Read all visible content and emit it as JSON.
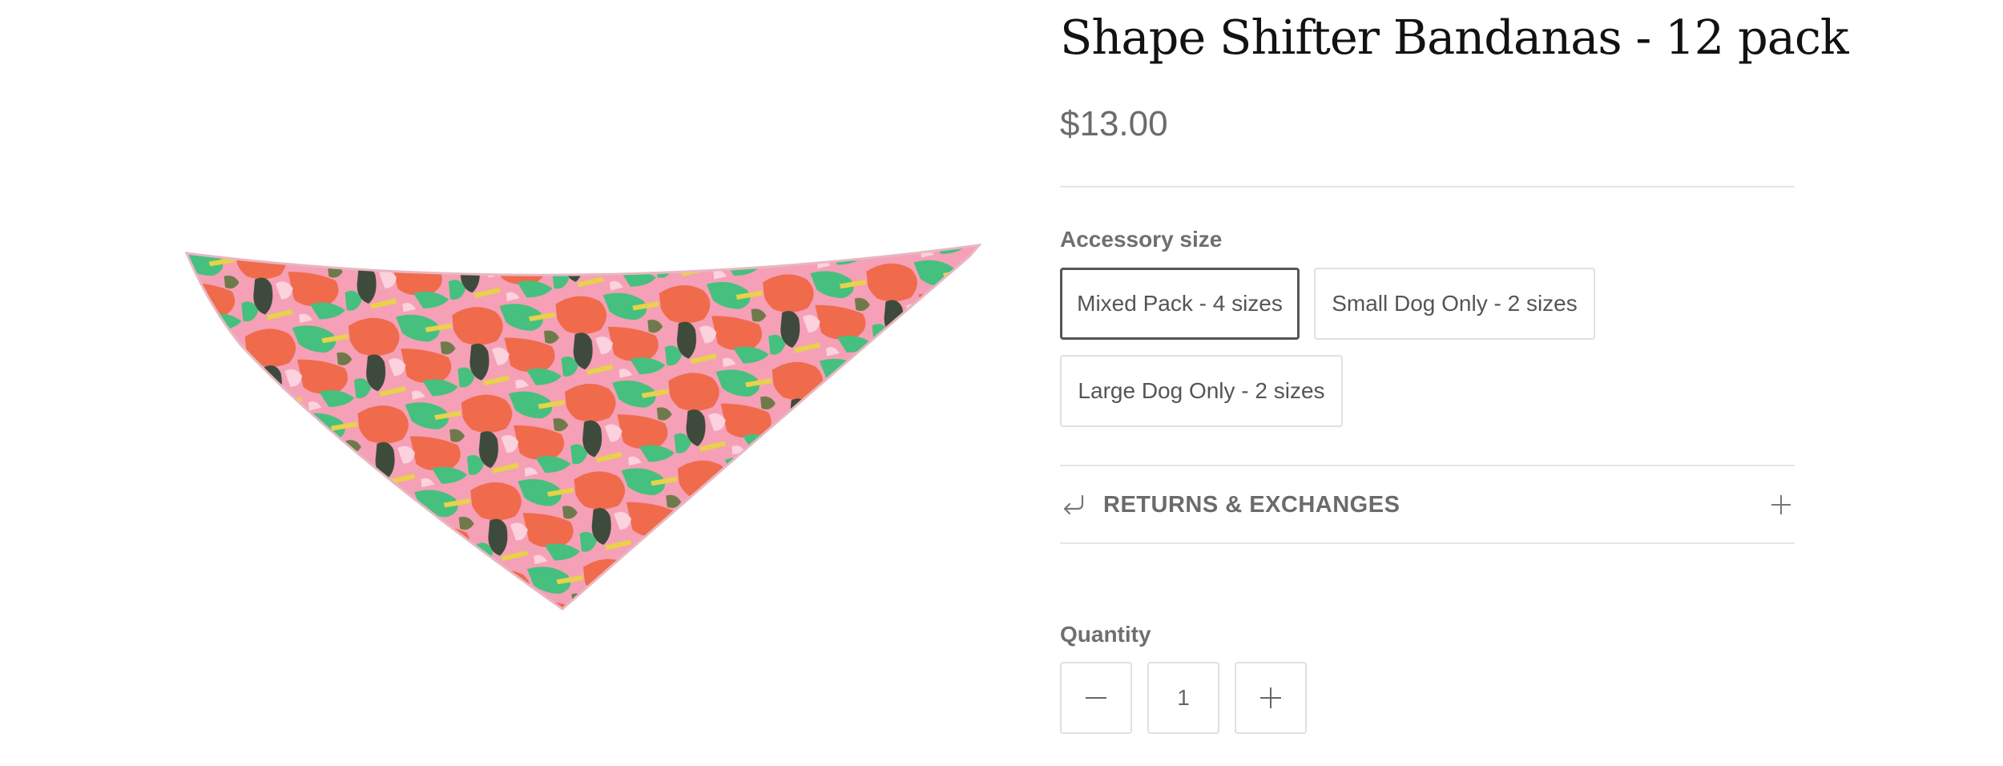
{
  "product": {
    "title": "Shape Shifter Bandanas - 12 pack",
    "price": "$13.00",
    "image_alt": "bandana-product-image"
  },
  "variants": {
    "label": "Accessory size",
    "options": [
      {
        "label": "Mixed Pack - 4 sizes",
        "selected": true
      },
      {
        "label": "Small Dog Only - 2 sizes",
        "selected": false
      },
      {
        "label": "Large Dog Only - 2 sizes",
        "selected": false
      }
    ]
  },
  "accordion": {
    "title": "RETURNS & EXCHANGES",
    "icon": "return-arrow-icon",
    "toggle_icon": "plus-icon"
  },
  "quantity": {
    "label": "Quantity",
    "value": "1",
    "decrease_icon": "minus-icon",
    "increase_icon": "plus-icon"
  },
  "colors": {
    "pattern_orange": "#f06a4c",
    "pattern_pink": "#f5a0b6",
    "pattern_lightpink": "#fbd2dd",
    "pattern_green": "#45c07e",
    "pattern_dark": "#3d4a3c",
    "pattern_yellow": "#e8d24a",
    "pattern_olive": "#6f7a4a"
  }
}
